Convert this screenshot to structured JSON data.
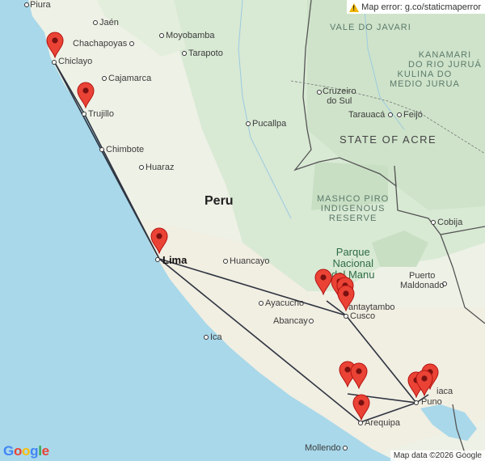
{
  "error_banner": "Map error: g.co/staticmaperror",
  "attribution": "Map data ©2026 Google",
  "logo": [
    "G",
    "o",
    "o",
    "g",
    "l",
    "e"
  ],
  "logo_colors": [
    "#4285F4",
    "#EA4335",
    "#FBBC05",
    "#4285F4",
    "#34A853",
    "#EA4335"
  ],
  "colors": {
    "water": "#a8d8ea",
    "land": "#eef1e6",
    "forest": "#d7e8d2",
    "route": "#2e3440",
    "pin": "#ea4335"
  },
  "country_label": "Peru",
  "regions": {
    "vale_do_javari": "VALE DO JAVARI",
    "kanamari": "KANAMARI\nDO RIO JURUÁ",
    "kulina": "KULINA DO\nMEDIO JURUA",
    "state_acre": "STATE OF ACRE",
    "mashco": "MASHCO PIRO\nINDIGENOUS\nRESERVE"
  },
  "park": "Parque\nNacional\ndel Manu",
  "cities": {
    "piura": "Piura",
    "jaen": "Jaén",
    "chachapoyas": "Chachapoyas",
    "moyobamba": "Moyobamba",
    "chiclayo": "Chiclayo",
    "tarapoto": "Tarapoto",
    "cajamarca": "Cajamarca",
    "trujillo": "Trujillo",
    "pucallpa": "Pucallpa",
    "chimbote": "Chimbote",
    "huaraz": "Huaraz",
    "lima": "Lima",
    "huancayo": "Huancayo",
    "ayacucho": "Ayacucho",
    "abancay": "Abancay",
    "ollantaytambo": "antaytambo",
    "cusco": "Cusco",
    "ica": "Ica",
    "puno": "Puno",
    "arequipa": "Arequipa",
    "mollendo": "Mollendo",
    "cruzeiro": "Cruzeiro\ndo Sul",
    "tarauaca": "Tarauacá",
    "feijo": "Feijó",
    "cobija": "Cobija",
    "puerto_maldonado": "Puerto\nMaldonado",
    "juliaca": "iaca"
  },
  "markers": [
    "Chiclayo",
    "Trujillo",
    "Lima",
    "Manu 1",
    "Manu 2",
    "Ollantaytambo",
    "Cusco area",
    "Colca 1",
    "Colca 2",
    "Arequipa",
    "Puno 1",
    "Puno 2",
    "Juliaca"
  ]
}
